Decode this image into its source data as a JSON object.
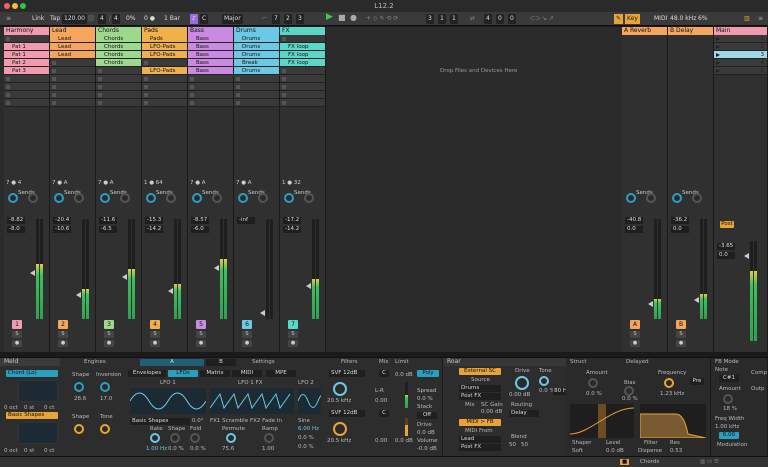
{
  "window": {
    "title": "L12.2"
  },
  "control_bar": {
    "link": "Link",
    "tap": "Tap",
    "tempo": "120.00",
    "sig_num": "4",
    "sig_den": "4",
    "swing": "0%",
    "metro_off": "0 ●",
    "quant": "1 Bar",
    "key_root": "C",
    "scale": "Major",
    "pos": [
      "7",
      "2",
      "3"
    ],
    "loop_start": [
      "3",
      "1",
      "1"
    ],
    "loop_len": [
      "4",
      "0",
      "0"
    ],
    "key_btn": "Key",
    "midi_btn": "MIDI",
    "cpu": "48.0 kHz",
    "cpu_pct": "6%",
    "colors": {
      "accent": "#e8a434",
      "play": "#3ec85a"
    }
  },
  "tracks": [
    {
      "name": "Harmony",
      "color": "#f29ab0",
      "clips": [
        "",
        "Pat 1",
        "Pat 1",
        "Pat 2",
        "Pat 3"
      ],
      "clipcolor": "#f29ab0",
      "num": "1",
      "vol": "-8.82",
      "pan": "-8.0",
      "meter": 0.55,
      "badge": "7",
      "badge2": "4"
    },
    {
      "name": "Lead",
      "color": "#f6a55d",
      "clips": [
        "Lead",
        "Lead",
        "Lead",
        "",
        ""
      ],
      "clipcolor": "#f6a55d",
      "num": "2",
      "vol": "-20.4",
      "pan": "-10.6",
      "meter": 0.3,
      "badge": "7",
      "badge2": "A"
    },
    {
      "name": "Chords",
      "color": "#9ed88d",
      "clips": [
        "Chords",
        "Chords",
        "Chords",
        "Chords",
        ""
      ],
      "clipcolor": "#9ed88d",
      "num": "3",
      "vol": "-11.6",
      "pan": "-6.5",
      "meter": 0.5,
      "badge": "7",
      "badge2": "A"
    },
    {
      "name": "Pads",
      "color": "#f0b04a",
      "clips": [
        "Pads",
        "LFO-Pads",
        "LFO-Pads",
        "",
        "LFO-Pads"
      ],
      "clipcolor": "#f0b04a",
      "num": "4",
      "vol": "-15.3",
      "pan": "-14.2",
      "meter": 0.35,
      "badge": "1",
      "badge2": "64"
    },
    {
      "name": "Bass",
      "color": "#c98ae0",
      "clips": [
        "Bass",
        "Bass",
        "Bass",
        "Bass",
        "Bass"
      ],
      "clipcolor": "#c98ae0",
      "num": "5",
      "vol": "-8.57",
      "pan": "-6.0",
      "meter": 0.6,
      "badge": "7",
      "badge2": "A"
    },
    {
      "name": "Drums",
      "color": "#6cc9e6",
      "clips": [
        "Drums",
        "Drums",
        "Drums",
        "Break",
        "Drums"
      ],
      "clipcolor": "#6cc9e6",
      "num": "6",
      "vol": "-inf",
      "pan": "",
      "meter": 0.0,
      "badge": "7",
      "badge2": "A"
    },
    {
      "name": "FX",
      "color": "#59d8c9",
      "clips": [
        "",
        "FX loop",
        "FX loop",
        "FX loop",
        ""
      ],
      "clipcolor": "#59d8c9",
      "num": "7",
      "vol": "-17.2",
      "pan": "-14.2",
      "meter": 0.4,
      "badge": "1",
      "badge2": "32"
    }
  ],
  "drop_text": "Drop Files and Devices Here",
  "returns": [
    {
      "name": "A Reverb",
      "color": "#f6a55d",
      "num": "A",
      "vol": "-40.8",
      "pan": "0.0",
      "meter": 0.2
    },
    {
      "name": "B Delay",
      "color": "#f6a55d",
      "num": "B",
      "vol": "-36.2",
      "pan": "0.0",
      "meter": 0.25
    }
  ],
  "main": {
    "name": "Main",
    "color": "#f29ab0",
    "vol": "-3.65",
    "pan": "0.0",
    "meter": 0.7,
    "scene_nums": [
      "1",
      "2",
      "3",
      "4",
      "5"
    ],
    "post": "Post"
  },
  "mixer_labels": {
    "sends": "Sends"
  },
  "devices": {
    "meld": {
      "title": "Meld",
      "engines": "Engines",
      "tab_a": "A",
      "tab_b": "B",
      "settings": "Settings",
      "osc_a": "Chord (Lo)",
      "osc_b": "Basic Shapes",
      "shape": "Shape",
      "inversion": "Inversion",
      "shape_val": "28.6",
      "inv_val": "17.0",
      "shape2": "Shape",
      "tone": "Tone",
      "oct": "0 oct",
      "st": "0 st",
      "ct": "0 ct",
      "env": "Envelopes",
      "lfos": "LFOs",
      "matrix": "Matrix",
      "midi": "MIDI",
      "mpe": "MPE",
      "lfo1": "LFO 1",
      "lfo1fx": "LFO 1 FX",
      "lfo2": "LFO 2",
      "bshapes": "Basic Shapes",
      "fx1": "FX1 Scramble",
      "fx2": "FX2 Fade In",
      "sine": "Sine",
      "rate": "Rate",
      "shape3": "Shape",
      "fold": "Fold",
      "rate_val": "1.00 Hz",
      "shape3_val": "0.0 %",
      "fold_val": "0.0 %",
      "permute": "Permute",
      "perm_val": "75.6",
      "ramp": "Ramp",
      "ramp_val": "1.00",
      "hz": "6.00 Hz",
      "hz2": "0.0 %",
      "zero": "0.0 %",
      "zero2": "0.0°"
    },
    "filters": {
      "title": "Filters",
      "mix": "Mix",
      "limit": "Limit",
      "svf1": "SVF 12dB",
      "svf2": "SVF 12dB",
      "freq1": "20.5 kHz",
      "freq2": "20.5 kHz",
      "c": "C",
      "lr": "L-R",
      "lr_val": "0.00",
      "vol": "0.0 dB",
      "spread": "Spread",
      "spread_val": "0.0 %",
      "stack": "Stack",
      "stack_val": "Off",
      "drive": "Drive",
      "drive_val": "0.0 dB",
      "volume": "Volume",
      "volume_val": "-0.0 dB",
      "vol2": "0.0 dB"
    },
    "roar": {
      "title": "Roar",
      "ext": "External SC",
      "source": "Source",
      "drums": "Drums",
      "postfx": "Post FX",
      "mix": "Mix",
      "sc_gain": "SC Gain",
      "sc_val": "0.00 dB",
      "midi_fb": "MIDI > FB Note",
      "midi_from": "MIDI From",
      "lead": "Lead",
      "postfx2": "Post FX",
      "drive": "Drive",
      "tone": "Tone",
      "drive_val": "0.00 dB",
      "tone_val": "0.0 %",
      "routing": "Routing",
      "delay": "Delay",
      "blend": "Blend",
      "blend_val": "50",
      "blend_val2": "50",
      "shaper": "Shaper",
      "soft": "Soft",
      "level": "Level",
      "level_val": "0.0 dB",
      "filter": "Filter",
      "disperse": "Disperse",
      "res": "Res",
      "res_val": "0.53",
      "hz80": "80 Hz",
      "comp": "Comp",
      "gain": "Gain"
    },
    "right": {
      "struct": "Struct",
      "delayed": "Delayed",
      "amount": "Amount",
      "amount_val": "0.0 %",
      "bias": "Bias",
      "bias_val": "0.0 %",
      "frequency": "Frequency",
      "freq_val": "1.23 kHz",
      "pre": "Pre",
      "fbmode": "FB Mode",
      "note": "Note",
      "amount2": "Amount",
      "amount2_val": "18 %",
      "freqwidth": "Freq Width",
      "fw_val": "1.00 kHz",
      "fw_val2": "6.00",
      "modulation": "Modulation",
      "cc": "C#1",
      "comp": "Comp",
      "output": "Outp"
    }
  },
  "status": {
    "track_name": "Chords"
  }
}
